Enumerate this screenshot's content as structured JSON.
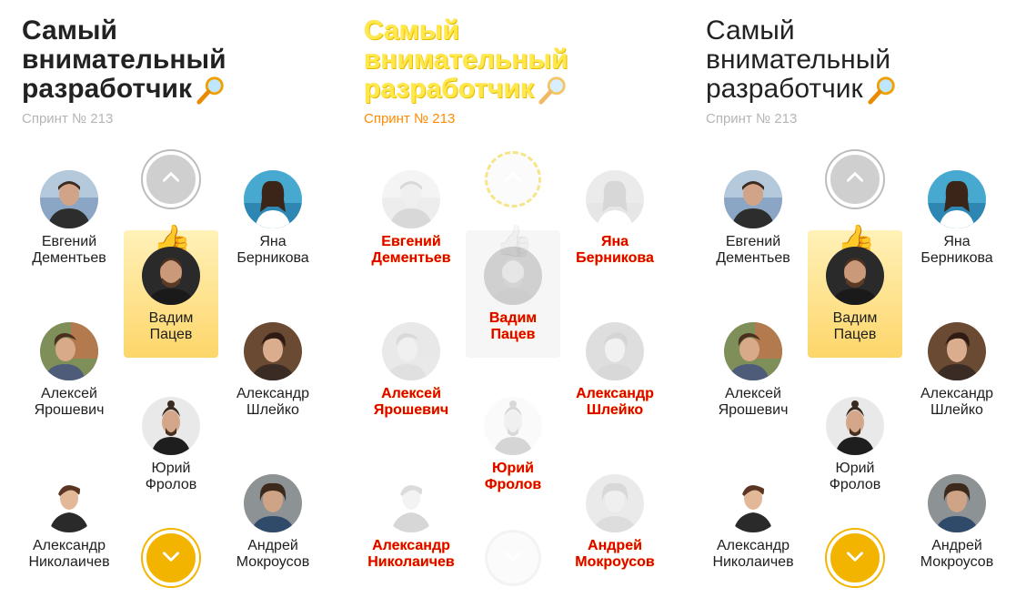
{
  "title": "Самый\nвнимательный\nразработчик",
  "title_icon": "magnifier-icon",
  "subtitle": "Спринт № 213",
  "people": {
    "evgeniy": "Евгений\nДементьев",
    "yana": "Яна\nБерникова",
    "vadim": "Вадим\nПацев",
    "aleksey": "Алексей\nЯрошевич",
    "shleyko": "Александр\nШлейко",
    "yuriy": "Юрий\nФролов",
    "nikolaichev": "Александр\nНиколаичев",
    "andrey": "Андрей\nМокроусов"
  },
  "winner_icon": "thumbs-up-icon",
  "nav": {
    "up_icon": "chevron-up-icon",
    "down_icon": "chevron-down-icon"
  },
  "colors": {
    "accent": "#f3b400",
    "highlight_top": "#fff1b8",
    "highlight_bottom": "#fdd66a",
    "muted": "#b5b5b5"
  }
}
